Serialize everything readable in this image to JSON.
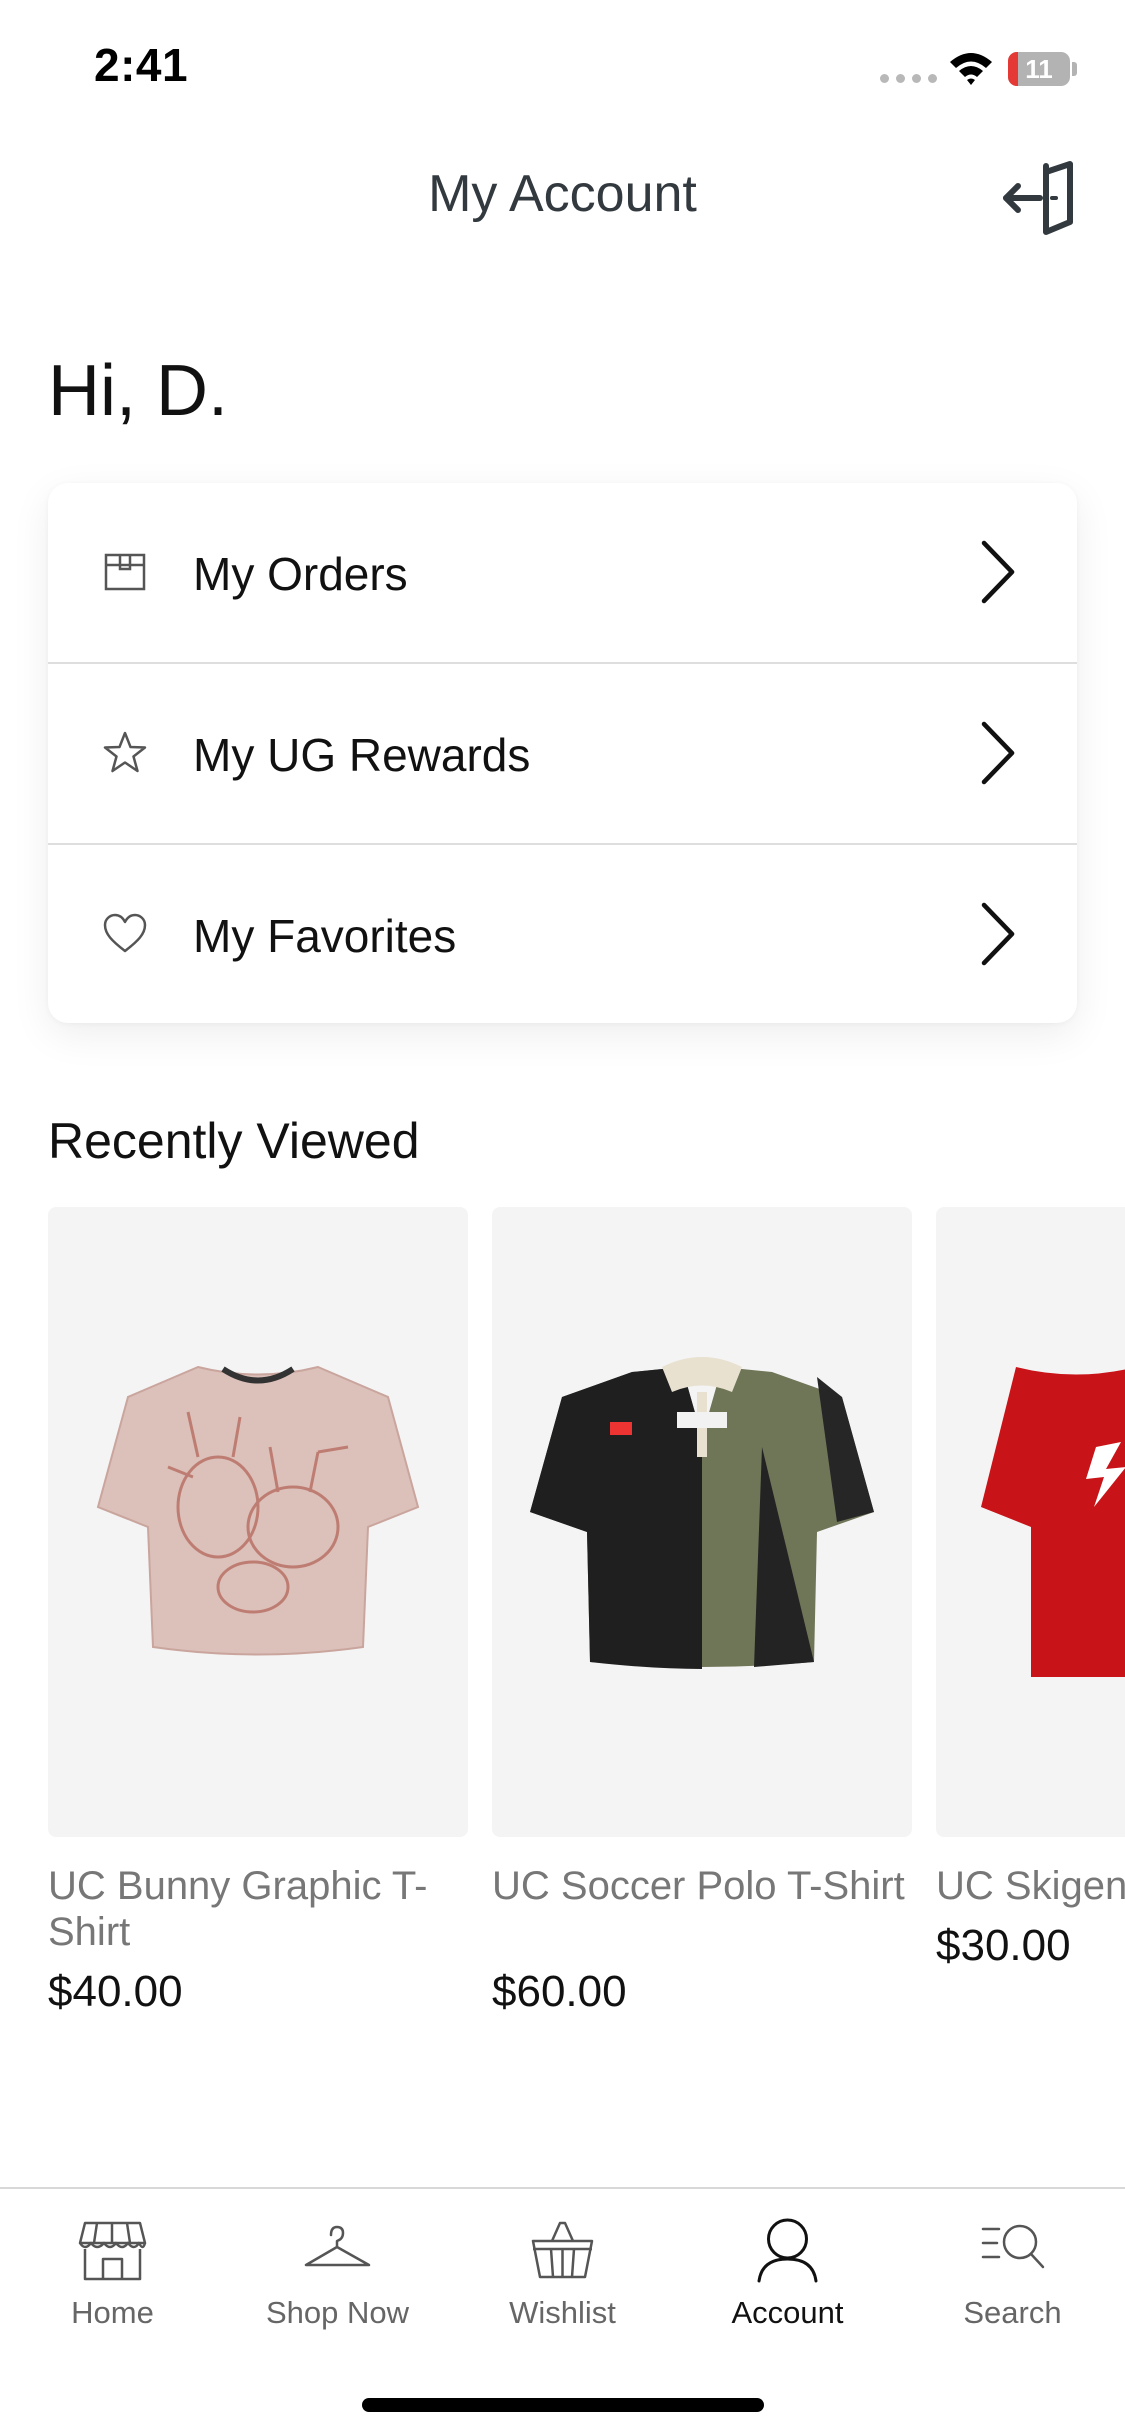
{
  "status_bar": {
    "time": "2:41",
    "battery": "11"
  },
  "header": {
    "title": "My Account",
    "logout_icon": "logout-icon"
  },
  "greeting": "Hi,  D.",
  "menu": [
    {
      "label": "My Orders",
      "icon": "box-icon"
    },
    {
      "label": "My UG Rewards",
      "icon": "star-icon"
    },
    {
      "label": "My Favorites",
      "icon": "heart-icon"
    }
  ],
  "recently_viewed": {
    "title": "Recently Viewed",
    "products": [
      {
        "name": "UC Bunny Graphic T-Shirt",
        "price": "$40.00",
        "color": "#dcc0ba"
      },
      {
        "name": "UC Soccer Polo T-Shirt",
        "price": "$60.00",
        "color": "#6f7557"
      },
      {
        "name": "UC Skigen",
        "price": "$30.00",
        "color": "#c81418"
      }
    ]
  },
  "tabs": [
    {
      "label": "Home",
      "icon": "store-icon",
      "active": false
    },
    {
      "label": "Shop Now",
      "icon": "hanger-icon",
      "active": false
    },
    {
      "label": "Wishlist",
      "icon": "basket-icon",
      "active": false
    },
    {
      "label": "Account",
      "icon": "person-icon",
      "active": true
    },
    {
      "label": "Search",
      "icon": "search-icon",
      "active": false
    }
  ]
}
